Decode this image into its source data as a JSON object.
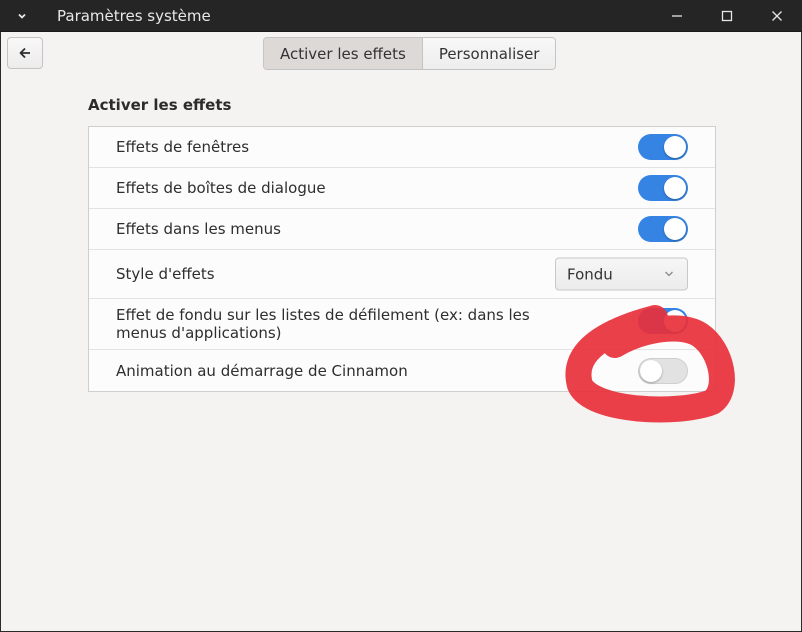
{
  "window": {
    "title": "Paramètres système"
  },
  "tabs": [
    {
      "label": "Activer les effets",
      "active": true
    },
    {
      "label": "Personnaliser",
      "active": false
    }
  ],
  "section": {
    "title": "Activer les effets"
  },
  "settings": [
    {
      "label": "Effets de fenêtres",
      "type": "switch",
      "value": true
    },
    {
      "label": "Effets de boîtes de dialogue",
      "type": "switch",
      "value": true
    },
    {
      "label": "Effets dans les menus",
      "type": "switch",
      "value": true
    },
    {
      "label": "Style d'effets",
      "type": "dropdown",
      "value": "Fondu"
    },
    {
      "label": "Effet de fondu sur les listes de défilement (ex: dans les menus d'applications)",
      "type": "switch",
      "value": true
    },
    {
      "label": "Animation au démarrage de Cinnamon",
      "type": "switch",
      "value": false
    }
  ],
  "colors": {
    "accent": "#3584e4",
    "titlebar": "#252525",
    "annotation": "#e8303a"
  },
  "icons": {
    "window_menu": "chevron-down-icon",
    "minimize": "minimize-icon",
    "maximize": "maximize-icon",
    "close": "close-icon",
    "back": "arrow-left-icon",
    "dropdown": "chevron-down-icon"
  }
}
